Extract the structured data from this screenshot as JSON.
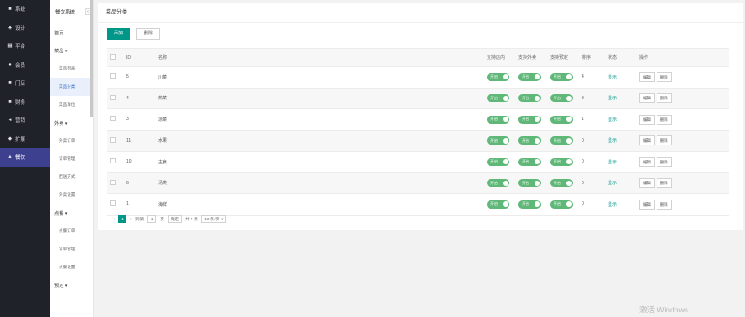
{
  "leftnav": {
    "items": [
      {
        "icon": "■",
        "icon_name": "system-icon",
        "label": "系统"
      },
      {
        "icon": "♣",
        "icon_name": "design-icon",
        "label": "设计"
      },
      {
        "icon": "▦",
        "icon_name": "platform-icon",
        "label": "平台"
      },
      {
        "icon": "●",
        "icon_name": "member-icon",
        "label": "会员"
      },
      {
        "icon": "■",
        "icon_name": "store-icon",
        "label": "门店"
      },
      {
        "icon": "■",
        "icon_name": "finance-icon",
        "label": "财务"
      },
      {
        "icon": "◂",
        "icon_name": "marketing-icon",
        "label": "营销"
      },
      {
        "icon": "◆",
        "icon_name": "extension-icon",
        "label": "扩展"
      },
      {
        "icon": "▲",
        "icon_name": "food-icon",
        "label": "餐饮"
      }
    ]
  },
  "subnav": {
    "title": "餐饮系统",
    "collapse": "«",
    "items": [
      {
        "type": "child-top",
        "label": "首页"
      },
      {
        "type": "group",
        "label": "菜品 ▾"
      },
      {
        "type": "child",
        "label": "菜品列表"
      },
      {
        "type": "child",
        "label": "菜品分类",
        "active": true
      },
      {
        "type": "child",
        "label": "菜品单位"
      },
      {
        "type": "group",
        "label": "外卖 ▾"
      },
      {
        "type": "child",
        "label": "外卖订单"
      },
      {
        "type": "child",
        "label": "订单管理"
      },
      {
        "type": "child",
        "label": "配送方式"
      },
      {
        "type": "child",
        "label": "外卖设置"
      },
      {
        "type": "group",
        "label": "点餐 ▾"
      },
      {
        "type": "child",
        "label": "点餐订单"
      },
      {
        "type": "child",
        "label": "订单管理"
      },
      {
        "type": "child",
        "label": "点餐设置"
      },
      {
        "type": "group",
        "label": "预定 ▾"
      }
    ]
  },
  "panel": {
    "title": "菜品分类",
    "add_label": "添加",
    "delete_label": "删除"
  },
  "table": {
    "headers": {
      "id": "ID",
      "name": "名称",
      "takeout": "支持店内",
      "pickup": "支持外卖",
      "reserve": "支持预定",
      "sort": "排序",
      "status": "状态",
      "ops": "操作"
    },
    "switch_label": "开启",
    "edit_label": "编辑",
    "delete_label": "删除",
    "rows": [
      {
        "id": "5",
        "name": "川菜",
        "sort": "4",
        "status": "显示"
      },
      {
        "id": "4",
        "name": "热菜",
        "sort": "3",
        "status": "显示"
      },
      {
        "id": "3",
        "name": "凉菜",
        "sort": "1",
        "status": "显示"
      },
      {
        "id": "11",
        "name": "水果",
        "sort": "0",
        "status": "显示"
      },
      {
        "id": "10",
        "name": "主食",
        "sort": "0",
        "status": "显示"
      },
      {
        "id": "6",
        "name": "汤类",
        "sort": "0",
        "status": "显示"
      },
      {
        "id": "1",
        "name": "海鲜",
        "sort": "0",
        "status": "显示"
      }
    ]
  },
  "pager": {
    "prev": "‹",
    "current": "1",
    "next": "›",
    "goto_prefix": "到第",
    "goto_value": "1",
    "goto_suffix": "页",
    "confirm": "确定",
    "total": "共 7 条",
    "page_size": "10 条/页",
    "page_size_caret": "▾"
  },
  "watermark": "激活 Windows",
  "colors": {
    "accent": "#009688",
    "nav_bg": "#20222a",
    "nav_active": "#3d3f8f",
    "switch_on": "#5fb878"
  }
}
